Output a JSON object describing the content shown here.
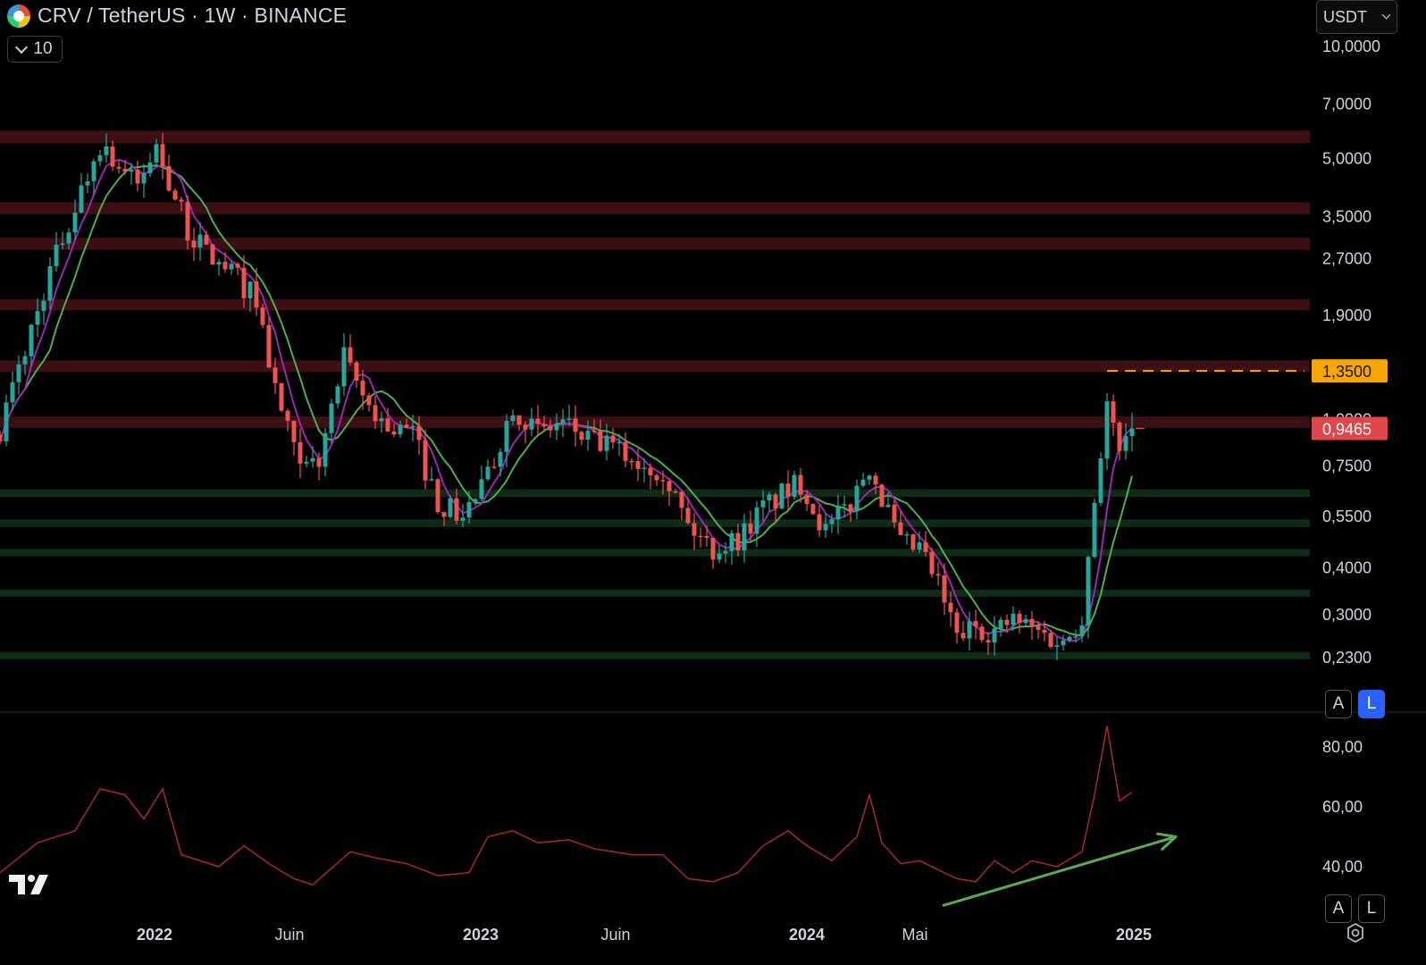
{
  "header": {
    "title": "CRV / TetherUS · 1W · BINANCE",
    "interval_value": "10",
    "currency": "USDT"
  },
  "price_scale": {
    "buttons": [
      "A",
      "L"
    ],
    "active_button": "L"
  },
  "indicator_scale": {
    "buttons": [
      "A",
      "L"
    ]
  },
  "icons": [
    "crv-logo-icon",
    "chevron-down-icon",
    "tradingview-logo-icon",
    "settings-icon"
  ],
  "colors": {
    "bull": "#26a69a",
    "bear": "#ef5350",
    "ma_fast": "#9c27b0",
    "ma_slow": "#4caf50",
    "resistance_zone": "#3b0f14",
    "support_zone": "#0f2a17",
    "current_price_badge": "#e0474c",
    "level_badge": "#f7a600",
    "rsi_line": "#a52a2a",
    "trend_arrow": "#5fa85a"
  },
  "chart_data": [
    {
      "type": "candlestick",
      "title": "CRV / TetherUS · 1W · BINANCE",
      "y_scale": "log",
      "ylim": [
        0.17,
        11.0
      ],
      "xlim": [
        "2021-07-12",
        "2025-03-31"
      ],
      "y_ticks": [
        "10,0000",
        "7,0000",
        "5,0000",
        "3,5000",
        "2,7000",
        "1,9000",
        "1,0000",
        "0,7500",
        "0,5500",
        "0,4000",
        "0,3000",
        "0,2300"
      ],
      "y_tick_values": [
        10.0,
        7.0,
        5.0,
        3.5,
        2.7,
        1.9,
        1.0,
        0.75,
        0.55,
        0.4,
        0.3,
        0.23
      ],
      "x_ticks": [
        "2022",
        "Juin",
        "2023",
        "Juin",
        "2024",
        "Mai",
        "2025"
      ],
      "x_tick_dates": [
        "2022-01-01",
        "2022-06-01",
        "2023-01-01",
        "2023-06-01",
        "2024-01-01",
        "2024-05-01",
        "2025-01-01"
      ],
      "current_price": {
        "value": 0.9465,
        "label": "0,9465"
      },
      "marked_level": {
        "value": 1.35,
        "label": "1,3500",
        "from": "2024-12-02",
        "style": "dashed"
      },
      "resistance_zones": [
        [
          5.5,
          5.95
        ],
        [
          3.55,
          3.82
        ],
        [
          2.85,
          3.07
        ],
        [
          1.96,
          2.1
        ],
        [
          1.34,
          1.44
        ],
        [
          0.95,
          1.02
        ]
      ],
      "support_zones": [
        [
          0.62,
          0.65
        ],
        [
          0.515,
          0.54
        ],
        [
          0.43,
          0.45
        ],
        [
          0.335,
          0.35
        ],
        [
          0.228,
          0.238
        ]
      ],
      "anchors": [
        [
          "2021-07-12",
          0.95
        ],
        [
          "2021-09-06",
          2.5
        ],
        [
          "2021-11-01",
          5.5
        ],
        [
          "2021-12-13",
          4.2
        ],
        [
          "2022-01-03",
          5.4
        ],
        [
          "2022-02-07",
          3.2
        ],
        [
          "2022-03-14",
          2.6
        ],
        [
          "2022-04-04",
          2.4
        ],
        [
          "2022-04-25",
          2.1
        ],
        [
          "2022-05-16",
          1.2
        ],
        [
          "2022-06-13",
          0.72
        ],
        [
          "2022-07-04",
          0.78
        ],
        [
          "2022-08-01",
          1.45
        ],
        [
          "2022-08-22",
          1.15
        ],
        [
          "2022-09-19",
          0.95
        ],
        [
          "2022-10-17",
          0.92
        ],
        [
          "2022-11-14",
          0.6
        ],
        [
          "2022-12-12",
          0.55
        ],
        [
          "2023-01-09",
          0.7
        ],
        [
          "2023-02-06",
          1.1
        ],
        [
          "2023-03-06",
          0.92
        ],
        [
          "2023-04-03",
          0.98
        ],
        [
          "2023-05-01",
          0.88
        ],
        [
          "2023-05-29",
          0.84
        ],
        [
          "2023-06-26",
          0.77
        ],
        [
          "2023-07-24",
          0.74
        ],
        [
          "2023-08-21",
          0.52
        ],
        [
          "2023-09-18",
          0.45
        ],
        [
          "2023-10-16",
          0.48
        ],
        [
          "2023-11-13",
          0.58
        ],
        [
          "2023-12-25",
          0.68
        ],
        [
          "2024-01-22",
          0.5
        ],
        [
          "2024-02-19",
          0.6
        ],
        [
          "2024-03-11",
          0.76
        ],
        [
          "2024-03-25",
          0.62
        ],
        [
          "2024-04-15",
          0.46
        ],
        [
          "2024-05-06",
          0.45
        ],
        [
          "2024-05-27",
          0.36
        ],
        [
          "2024-06-17",
          0.26
        ],
        [
          "2024-07-08",
          0.28
        ],
        [
          "2024-07-29",
          0.27
        ],
        [
          "2024-08-19",
          0.29
        ],
        [
          "2024-09-16",
          0.27
        ],
        [
          "2024-10-14",
          0.25
        ],
        [
          "2024-11-04",
          0.3
        ],
        [
          "2024-11-18",
          0.62
        ],
        [
          "2024-12-02",
          1.1
        ],
        [
          "2024-12-16",
          0.8
        ],
        [
          "2024-12-30",
          0.9465
        ]
      ],
      "series": [
        {
          "type": "moving_average",
          "color": "ma_fast"
        },
        {
          "type": "moving_average",
          "color": "ma_slow"
        }
      ]
    },
    {
      "type": "line",
      "ylim": [
        33,
        88
      ],
      "y_ticks": [
        "80,00",
        "60,00",
        "40,00"
      ],
      "y_tick_values": [
        80,
        60,
        40
      ],
      "values": [
        [
          "2021-07-12",
          38
        ],
        [
          "2021-08-23",
          48
        ],
        [
          "2021-10-04",
          52
        ],
        [
          "2021-11-01",
          66
        ],
        [
          "2021-11-29",
          64
        ],
        [
          "2021-12-20",
          56
        ],
        [
          "2022-01-10",
          66
        ],
        [
          "2022-01-31",
          44
        ],
        [
          "2022-03-14",
          40
        ],
        [
          "2022-04-11",
          47
        ],
        [
          "2022-05-09",
          41
        ],
        [
          "2022-06-06",
          36
        ],
        [
          "2022-06-27",
          34
        ],
        [
          "2022-08-08",
          45
        ],
        [
          "2022-09-05",
          43
        ],
        [
          "2022-10-10",
          41
        ],
        [
          "2022-11-14",
          37
        ],
        [
          "2022-12-19",
          38
        ],
        [
          "2023-01-09",
          50
        ],
        [
          "2023-02-06",
          52
        ],
        [
          "2023-03-06",
          48
        ],
        [
          "2023-04-10",
          49
        ],
        [
          "2023-05-08",
          46
        ],
        [
          "2023-06-19",
          44
        ],
        [
          "2023-07-24",
          44
        ],
        [
          "2023-08-21",
          36
        ],
        [
          "2023-09-18",
          35
        ],
        [
          "2023-10-16",
          38
        ],
        [
          "2023-11-13",
          47
        ],
        [
          "2023-12-11",
          52
        ],
        [
          "2024-01-01",
          47
        ],
        [
          "2024-01-29",
          42
        ],
        [
          "2024-02-26",
          50
        ],
        [
          "2024-03-11",
          64
        ],
        [
          "2024-03-25",
          48
        ],
        [
          "2024-04-15",
          41
        ],
        [
          "2024-05-06",
          42
        ],
        [
          "2024-05-27",
          39
        ],
        [
          "2024-06-17",
          36
        ],
        [
          "2024-07-08",
          35
        ],
        [
          "2024-07-29",
          42
        ],
        [
          "2024-08-19",
          38
        ],
        [
          "2024-09-09",
          42
        ],
        [
          "2024-10-07",
          40
        ],
        [
          "2024-11-04",
          45
        ],
        [
          "2024-11-18",
          64
        ],
        [
          "2024-12-02",
          87
        ],
        [
          "2024-12-16",
          62
        ],
        [
          "2024-12-30",
          65
        ]
      ],
      "trend_arrow": {
        "from": [
          "2024-06-01",
          27
        ],
        "to": [
          "2025-02-17",
          50
        ]
      }
    }
  ]
}
